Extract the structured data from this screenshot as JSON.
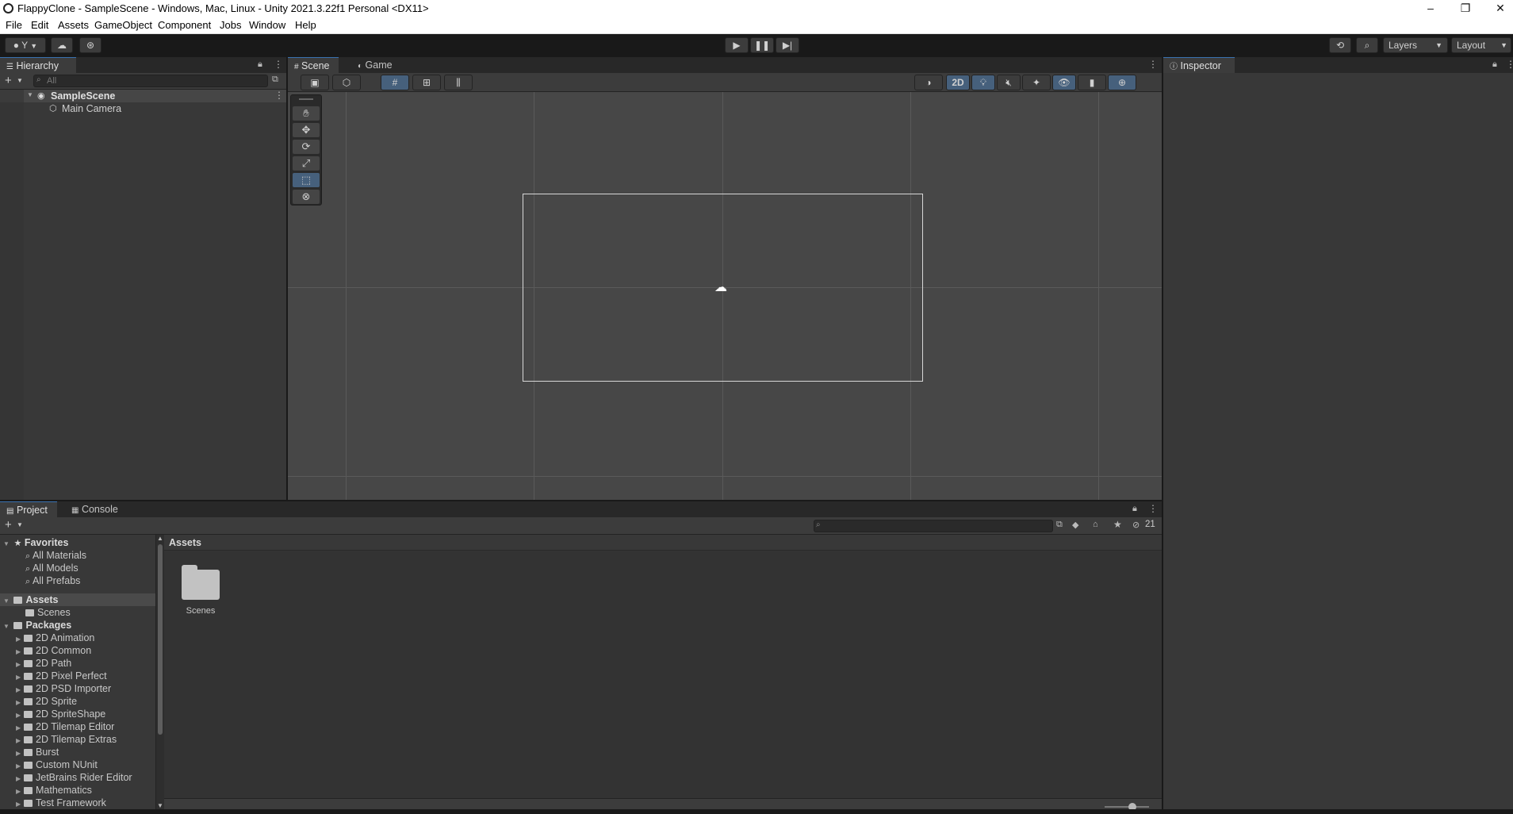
{
  "window": {
    "title": "FlappyClone - SampleScene - Windows, Mac, Linux - Unity 2021.3.22f1 Personal <DX11>",
    "minimize": "–",
    "restore": "❐",
    "close": "✕"
  },
  "menu": [
    "File",
    "Edit",
    "Assets",
    "GameObject",
    "Component",
    "Jobs",
    "Window",
    "Help"
  ],
  "toolbar": {
    "account_label": "Y",
    "play_icon": "play-icon",
    "pause_icon": "pause-icon",
    "step_icon": "step-icon",
    "layers_label": "Layers",
    "layout_label": "Layout"
  },
  "hierarchy": {
    "tab_label": "Hierarchy",
    "search_placeholder": "All",
    "scene_name": "SampleScene",
    "items": [
      "Main Camera"
    ]
  },
  "scene": {
    "tabs": [
      "Scene",
      "Game"
    ],
    "mode_2d_label": "2D"
  },
  "inspector": {
    "tab_label": "Inspector"
  },
  "project": {
    "tabs": [
      "Project",
      "Console"
    ],
    "hidden_packages_count": "21",
    "breadcrumb": "Assets",
    "favorites": {
      "label": "Favorites",
      "items": [
        "All Materials",
        "All Models",
        "All Prefabs"
      ]
    },
    "assets": {
      "label": "Assets",
      "items": [
        "Scenes"
      ]
    },
    "packages": {
      "label": "Packages",
      "items": [
        "2D Animation",
        "2D Common",
        "2D Path",
        "2D Pixel Perfect",
        "2D PSD Importer",
        "2D Sprite",
        "2D SpriteShape",
        "2D Tilemap Editor",
        "2D Tilemap Extras",
        "Burst",
        "Custom NUnit",
        "JetBrains Rider Editor",
        "Mathematics",
        "Test Framework"
      ]
    },
    "grid_items": [
      {
        "label": "Scenes",
        "icon": "folder-icon"
      }
    ]
  }
}
